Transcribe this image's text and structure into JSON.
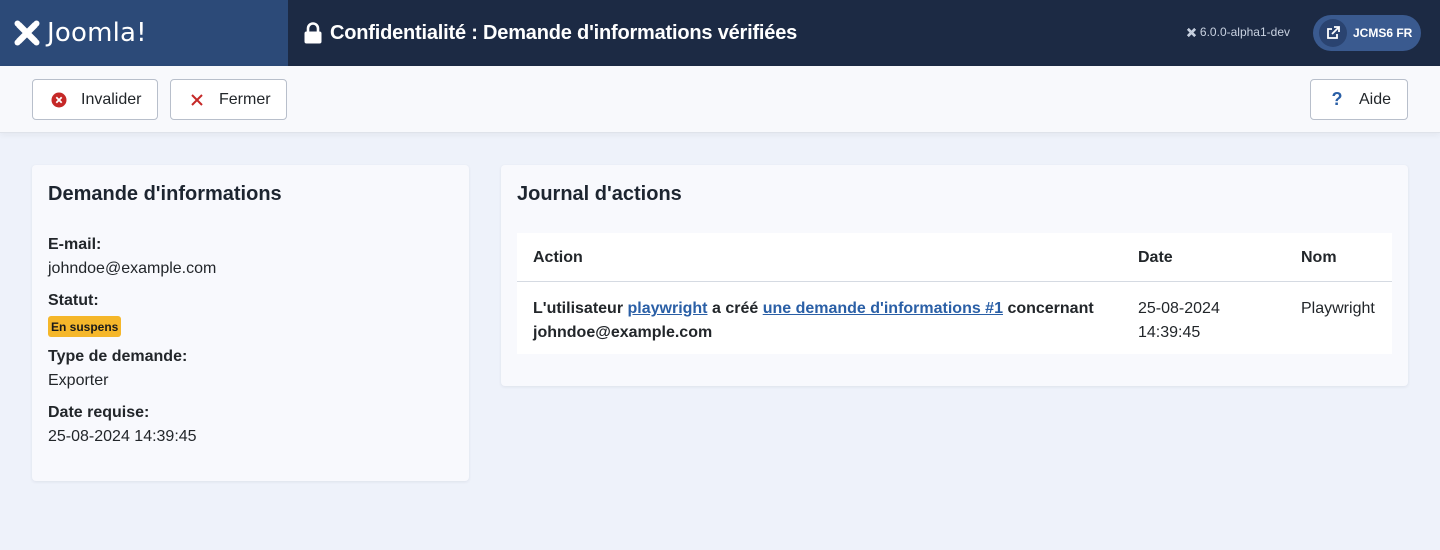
{
  "header": {
    "brand": "Joomla!",
    "title": "Confidentialité : Demande d'informations vérifiées",
    "version": "6.0.0-alpha1-dev",
    "site_button": "JCMS6 FR"
  },
  "toolbar": {
    "invalidate_label": "Invalider",
    "close_label": "Fermer",
    "help_label": "Aide"
  },
  "request": {
    "title": "Demande d'informations",
    "email_label": "E-mail:",
    "email_value": "johndoe@example.com",
    "status_label": "Statut:",
    "status_value": "En suspens",
    "type_label": "Type de demande:",
    "type_value": "Exporter",
    "date_label": "Date requise:",
    "date_value": "25-08-2024 14:39:45"
  },
  "log": {
    "title": "Journal d'actions",
    "columns": {
      "action": "Action",
      "date": "Date",
      "name": "Nom"
    },
    "rows": [
      {
        "action_prefix": "L'utilisateur",
        "user_link": "playwright",
        "action_middle": "a créé",
        "request_link": "une demande d'informations #1",
        "action_suffix": "concernant johndoe@example.com",
        "date_line1": "25-08-2024",
        "date_line2": "14:39:45",
        "name": "Playwright"
      }
    ]
  },
  "colors": {
    "header_bg": "#1c2a44",
    "brand_bg": "#2c4a78",
    "status_badge": "#f5b72a",
    "link": "#2a5fa6",
    "invalidate_icon": "#c52827"
  },
  "icons": {
    "brand": "joomla-logo-icon",
    "title": "lock-icon",
    "version": "joomla-mini-icon",
    "site": "external-link-icon",
    "invalidate": "times-circle-icon",
    "close": "close-icon",
    "help": "question-icon"
  }
}
